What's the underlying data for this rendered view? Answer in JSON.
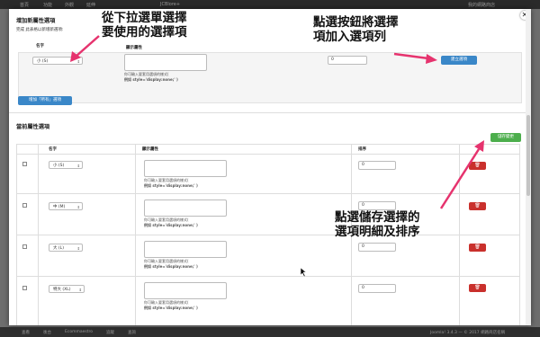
{
  "topbar": {
    "items": [
      "首頁",
      "功能",
      "外觀",
      "延伸",
      "JCBlore+"
    ],
    "right": "我的網路商店"
  },
  "bottombar": {
    "left_items": [
      "查看",
      "後台",
      "Ecommaestro",
      "追蹤",
      "查詢"
    ],
    "right": "Joomla! 3.4.3  —  © 2017 網路商店名稱"
  },
  "new_section": {
    "title": "增加新屬性選項",
    "hint": "完成 此表格以新增新選項:",
    "name_header": "名字",
    "display_header": "顯示屬性",
    "select_value": "小 (S)",
    "help_line1": "你可輸入要套用選項的樣式(",
    "help_line2": "例如 style='display:none;' )",
    "order_value": "0",
    "create_button": "建立選項",
    "add_all_button": "增加「所有」選項"
  },
  "current_section": {
    "title": "當前屬性選項",
    "save_button": "儲存變更",
    "headers": {
      "name": "名字",
      "display": "顯示屬性",
      "order": "排序"
    },
    "help_line1": "你可輸入要套用選項的樣式(",
    "help_line2": "例如 style='display:none;' )",
    "rows": [
      {
        "name": "小 (S)",
        "order": "0"
      },
      {
        "name": "中 (M)",
        "order": "0"
      },
      {
        "name": "大 (L)",
        "order": "0"
      },
      {
        "name": "特大 (XL)",
        "order": "0"
      }
    ]
  },
  "annotations": {
    "a1_line1": "從下拉選單選擇",
    "a1_line2": "要使用的選擇項",
    "a2_line1": "點選按鈕將選擇",
    "a2_line2": "項加入選項列",
    "a3_line1": "點選儲存選擇的",
    "a3_line2": "選項明細及排序"
  },
  "icons": {
    "close": "close-icon",
    "trash": "trash-icon",
    "arrow_color": "#e6336e"
  },
  "colors": {
    "blue": "#3a87c8",
    "green": "#4cae4c",
    "red": "#c9302c",
    "arrow": "#e6336e"
  }
}
